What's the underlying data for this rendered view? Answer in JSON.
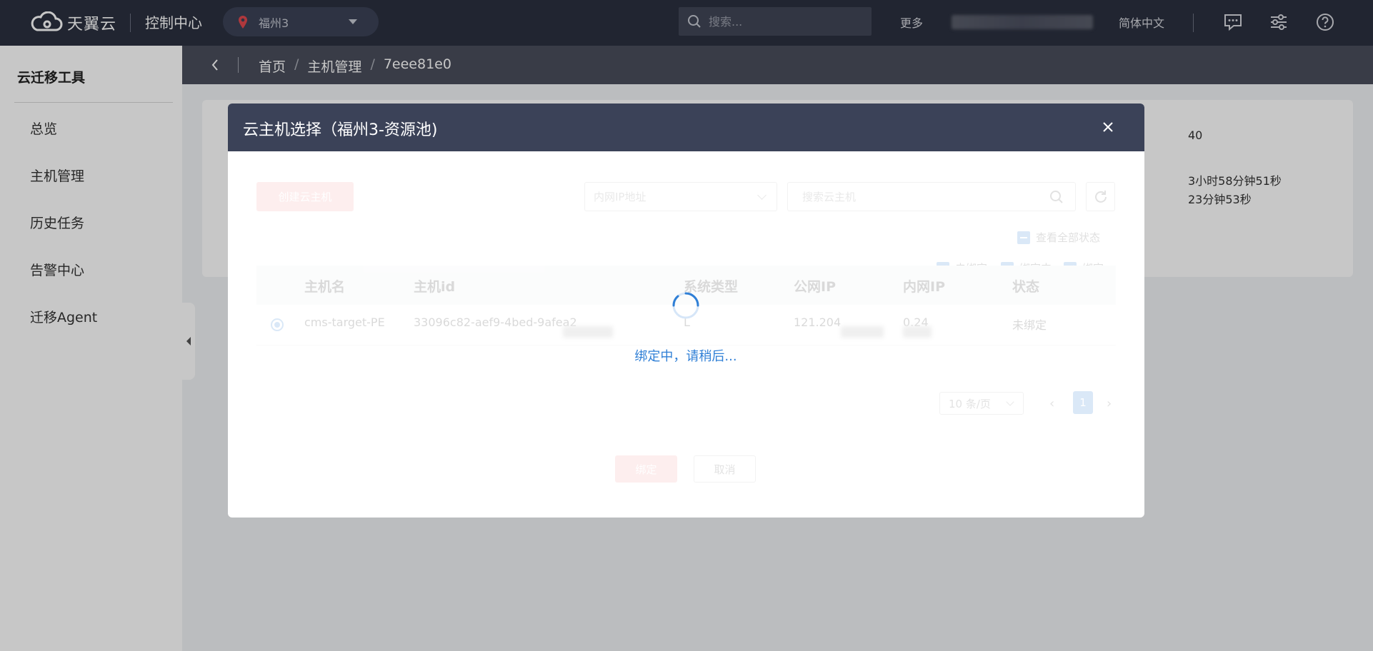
{
  "topbar": {
    "logo_text": "天翼云",
    "console_title": "控制中心",
    "region": "福州3",
    "search_placeholder": "搜索...",
    "more": "更多",
    "language": "简体中文"
  },
  "sidebar": {
    "title": "云迁移工具",
    "items": [
      {
        "label": "总览"
      },
      {
        "label": "主机管理"
      },
      {
        "label": "历史任务"
      },
      {
        "label": "告警中心"
      },
      {
        "label": "迁移Agent"
      }
    ]
  },
  "breadcrumb": {
    "items": [
      "首页",
      "主机管理",
      "7eee81e0"
    ],
    "separator": "/"
  },
  "background_card": {
    "value_1": "40",
    "value_2": "3小时58分钟51秒",
    "value_3": "23分钟53秒"
  },
  "modal": {
    "title": "云主机选择（福州3-资源池)",
    "create_button": "创建云主机",
    "ip_select": "内网IP地址",
    "search_placeholder": "搜索云主机",
    "view_all_status": "查看全部状态",
    "filters": [
      "未绑定",
      "绑定中",
      "绑定"
    ],
    "table": {
      "headers": [
        "主机名",
        "主机id",
        "系统类型",
        "公网IP",
        "内网IP",
        "状态"
      ],
      "rows": [
        {
          "name": "cms-target-PE",
          "id": "33096c82-aef9-4bed-9afe",
          "id_suffix": "a2",
          "os": "L",
          "public_ip": "121.204",
          "private_ip_suffix": "0.24",
          "status": "未绑定"
        }
      ]
    },
    "pagination": {
      "page_size": "10 条/页",
      "current_page": "1"
    },
    "bind_button": "绑定",
    "cancel_button": "取消",
    "loading_text": "绑定中，请稍后..."
  },
  "colors": {
    "topbar": "#2b303f",
    "modal_header": "#3b4258",
    "accent_blue": "#2f7fd6",
    "danger_light": "#f7a3a5"
  }
}
